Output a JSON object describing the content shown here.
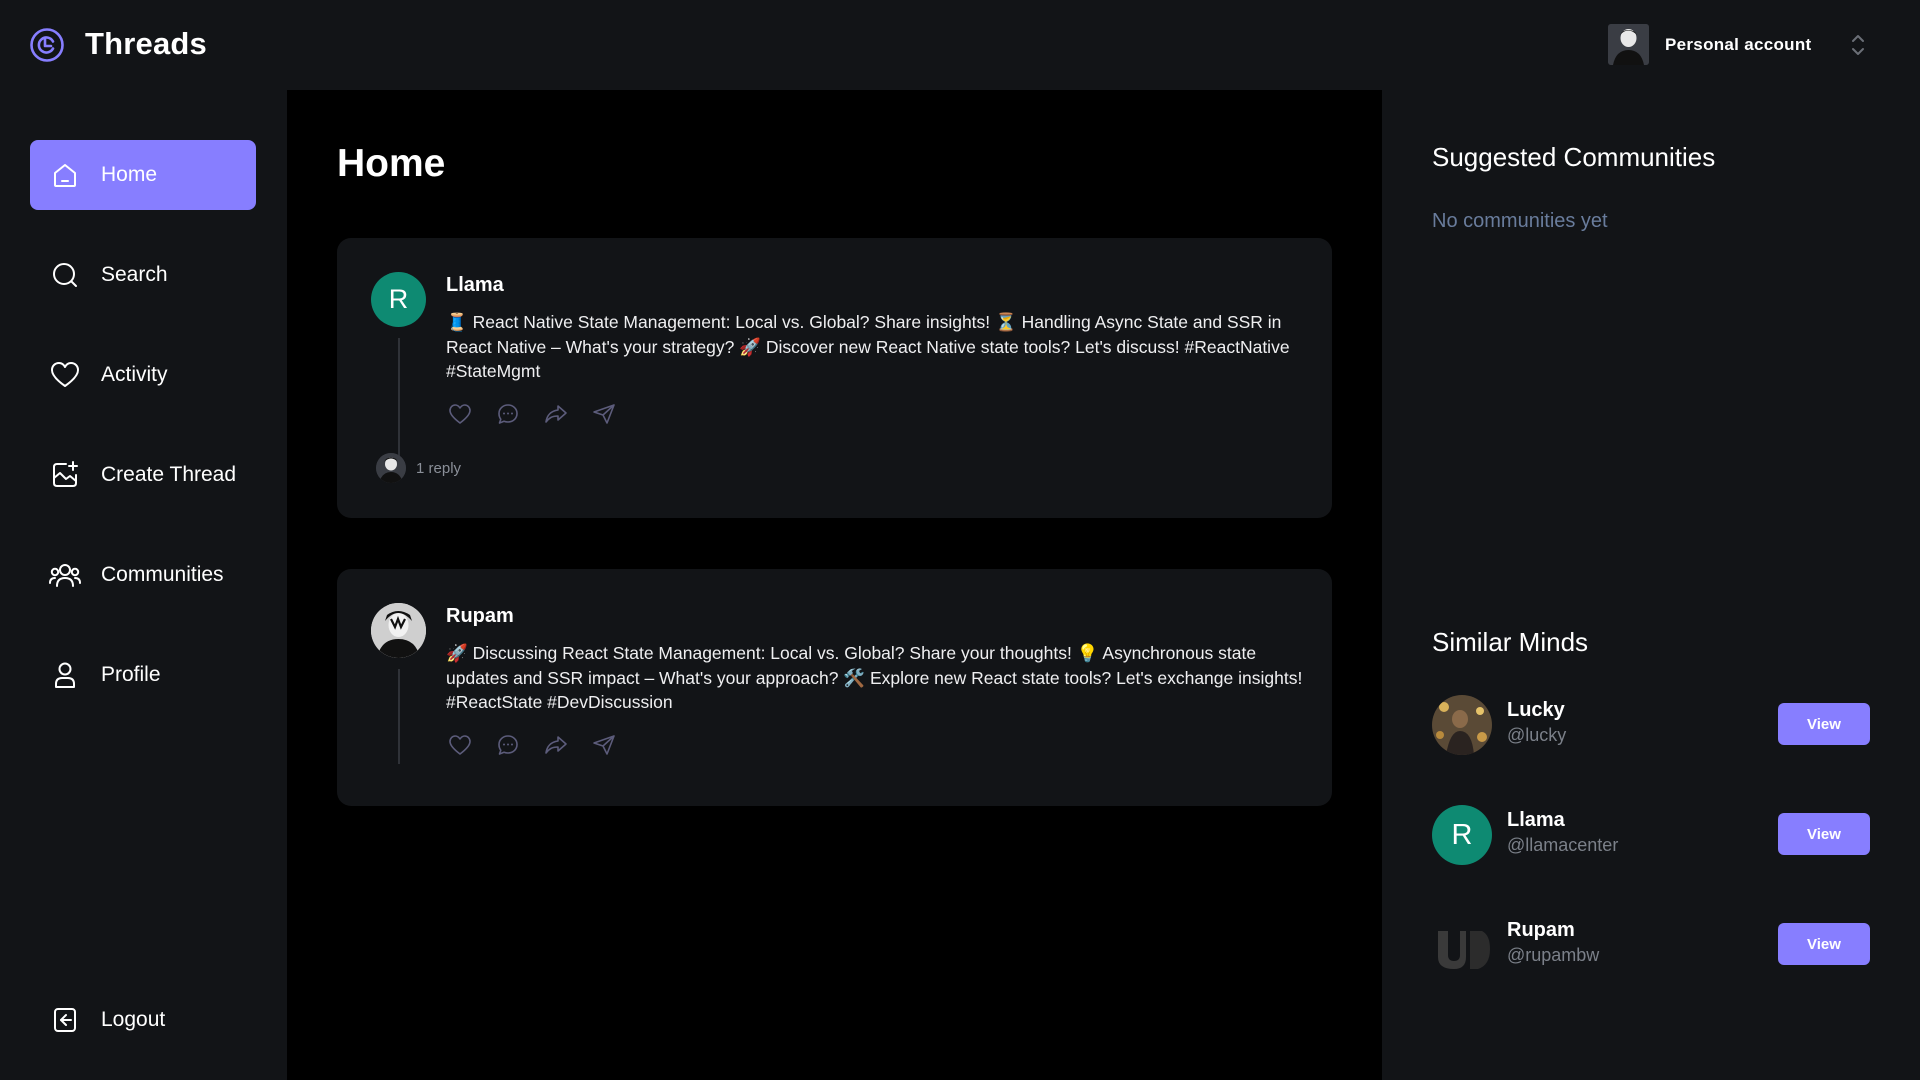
{
  "brand": {
    "name": "Threads",
    "logo_icon": "threads-logo-icon",
    "accent": "#877eff"
  },
  "account": {
    "label": "Personal account",
    "switcher_icon": "chevrons-up-down-icon"
  },
  "sidebar": {
    "items": [
      {
        "label": "Home",
        "icon": "home-icon",
        "active": true
      },
      {
        "label": "Search",
        "icon": "search-icon"
      },
      {
        "label": "Activity",
        "icon": "heart-icon"
      },
      {
        "label": "Create Thread",
        "icon": "create-thread-icon"
      },
      {
        "label": "Communities",
        "icon": "communities-icon"
      },
      {
        "label": "Profile",
        "icon": "profile-icon"
      }
    ],
    "logout": {
      "label": "Logout",
      "icon": "logout-icon"
    }
  },
  "main": {
    "title": "Home",
    "threads": [
      {
        "author": "Llama",
        "avatar_letter": "R",
        "text": "🧵 React Native State Management: Local vs. Global? Share insights! ⏳ Handling Async State and SSR in React Native – What's your strategy? 🚀 Discover new React Native state tools? Let's discuss! #ReactNative #StateMgmt",
        "reply_label": "1 reply"
      },
      {
        "author": "Rupam",
        "text": "🚀 Discussing React State Management: Local vs. Global? Share your thoughts! 💡 Asynchronous state updates and SSR impact – What's your approach? 🛠️ Explore new React state tools? Let's exchange insights! #ReactState #DevDiscussion"
      }
    ],
    "action_icons": [
      "heart-icon",
      "reply-icon",
      "repost-icon",
      "share-icon"
    ]
  },
  "right": {
    "communities_title": "Suggested Communities",
    "communities_empty": "No communities yet",
    "minds_title": "Similar Minds",
    "minds": [
      {
        "name": "Lucky",
        "handle": "@lucky",
        "button": "View"
      },
      {
        "name": "Llama",
        "handle": "@llamacenter",
        "avatar_letter": "R",
        "button": "View"
      },
      {
        "name": "Rupam",
        "handle": "@rupambw",
        "button": "View"
      }
    ]
  }
}
